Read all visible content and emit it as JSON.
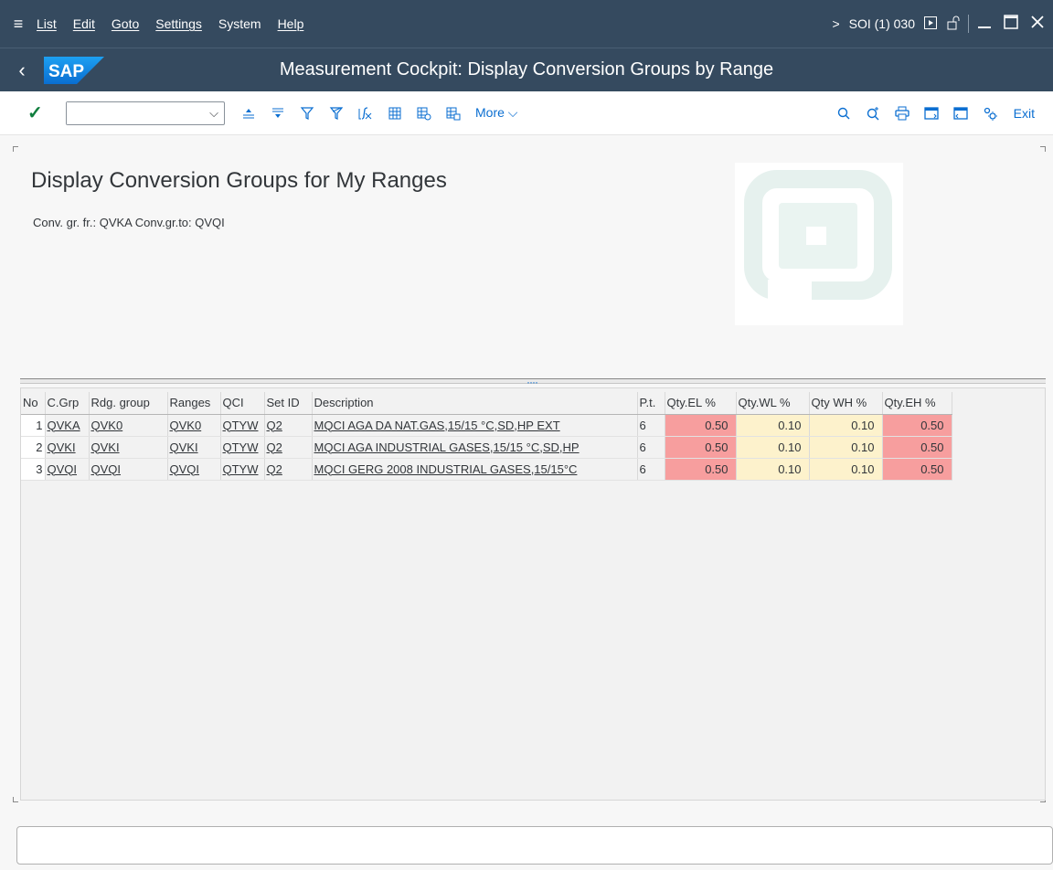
{
  "menubar": {
    "items": [
      "List",
      "Edit",
      "Goto",
      "Settings",
      "System",
      "Help"
    ],
    "system_info": "SOI (1) 030"
  },
  "titlebar": {
    "title": "Measurement Cockpit: Display Conversion Groups by Range",
    "logo_text": "SAP"
  },
  "toolbar": {
    "command_value": "",
    "more_label": "More",
    "exit_label": "Exit"
  },
  "header": {
    "title": "Display Conversion Groups for My Ranges",
    "subtitle": "Conv. gr. fr.: QVKA Conv.gr.to: QVQI"
  },
  "table": {
    "columns": [
      "No",
      "C.Grp",
      "Rdg. group",
      "Ranges",
      "QCI",
      "Set ID",
      "Description",
      "P.t.",
      "Qty.EL %",
      "Qty.WL %",
      "Qty WH %",
      "Qty.EH %"
    ],
    "rows": [
      [
        "1",
        "QVKA",
        "QVK0",
        "QVK0",
        "QTYW",
        "Q2",
        "MQCI AGA DA NAT.GAS,15/15 °C,SD,HP EXT",
        "6",
        "0.50",
        "0.10",
        "0.10",
        "0.50"
      ],
      [
        "2",
        "QVKI",
        "QVKI",
        "QVKI",
        "QTYW",
        "Q2",
        "MQCI AGA INDUSTRIAL GASES,15/15 °C,SD,HP",
        "6",
        "0.50",
        "0.10",
        "0.10",
        "0.50"
      ],
      [
        "3",
        "QVQI",
        "QVQI",
        "QVQI",
        "QTYW",
        "Q2",
        "MQCI GERG 2008 INDUSTRIAL GASES,15/15°C",
        "6",
        "0.50",
        "0.10",
        "0.10",
        "0.50"
      ]
    ]
  },
  "colors": {
    "shell": "#354a5f",
    "accent": "#0a6ed1",
    "threshold_high": "#f79e9e",
    "threshold_low": "#fdf2cc"
  }
}
